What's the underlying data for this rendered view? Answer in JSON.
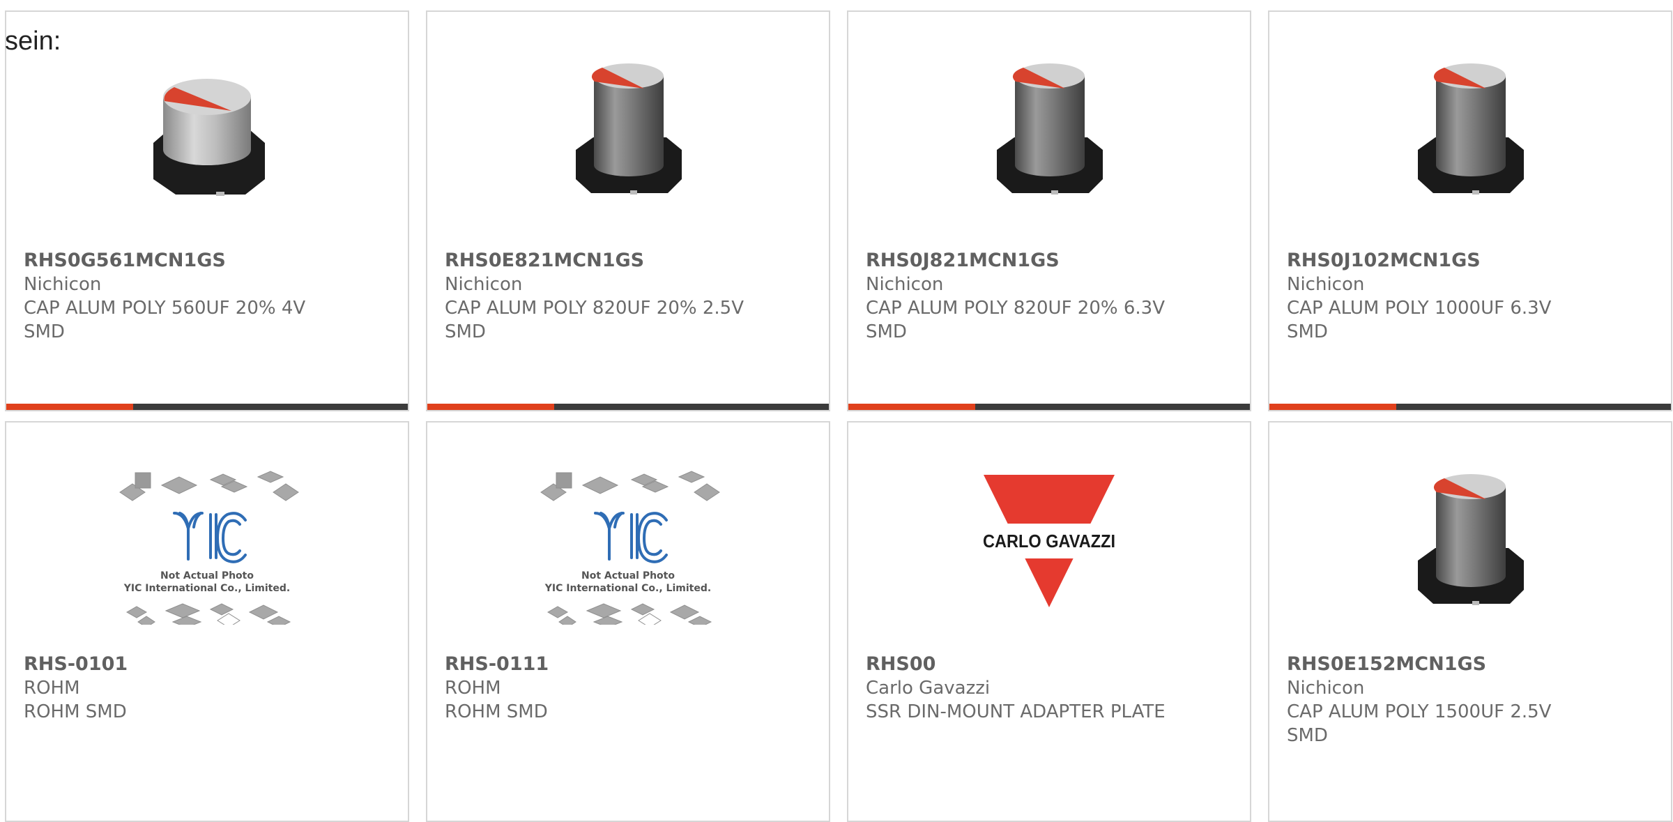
{
  "page": {
    "cut_text": "sein:"
  },
  "products": [
    {
      "part_number": "RHS0G561MCN1GS",
      "manufacturer": "Nichicon",
      "description": "CAP ALUM POLY 560UF 20% 4V SMD",
      "image": "capacitor-wide-icon",
      "has_bar": true
    },
    {
      "part_number": "RHS0E821MCN1GS",
      "manufacturer": "Nichicon",
      "description": "CAP ALUM POLY 820UF 20% 2.5V SMD",
      "image": "capacitor-tall-icon",
      "has_bar": true
    },
    {
      "part_number": "RHS0J821MCN1GS",
      "manufacturer": "Nichicon",
      "description": "CAP ALUM POLY 820UF 20% 6.3V SMD",
      "image": "capacitor-tall-icon",
      "has_bar": true
    },
    {
      "part_number": "RHS0J102MCN1GS",
      "manufacturer": "Nichicon",
      "description": "CAP ALUM POLY 1000UF 6.3V SMD",
      "image": "capacitor-tall-icon",
      "has_bar": true
    },
    {
      "part_number": "RHS-0101",
      "manufacturer": "ROHM",
      "description": "ROHM SMD",
      "image": "yic-not-actual-photo-icon",
      "image_caption_1": "Not Actual Photo",
      "image_caption_2": "YIC International Co., Limited.",
      "has_bar": false
    },
    {
      "part_number": "RHS-0111",
      "manufacturer": "ROHM",
      "description": "ROHM SMD",
      "image": "yic-not-actual-photo-icon",
      "image_caption_1": "Not Actual Photo",
      "image_caption_2": "YIC International Co., Limited.",
      "has_bar": false
    },
    {
      "part_number": "RHS00",
      "manufacturer": "Carlo Gavazzi",
      "description": "SSR DIN-MOUNT ADAPTER PLATE",
      "image": "carlo-gavazzi-logo",
      "logo_text": "CARLO GAVAZZI",
      "has_bar": false
    },
    {
      "part_number": "RHS0E152MCN1GS",
      "manufacturer": "Nichicon",
      "description": "CAP ALUM POLY 1500UF 2.5V SMD",
      "image": "capacitor-tall-icon",
      "has_bar": false
    }
  ],
  "colors": {
    "accent": "#e0401c",
    "bar_dark": "#3b3b3b",
    "card_border": "#d6d6d6",
    "text": "#666666",
    "logo_red": "#e53a2f",
    "yic_blue": "#2f6db5"
  }
}
